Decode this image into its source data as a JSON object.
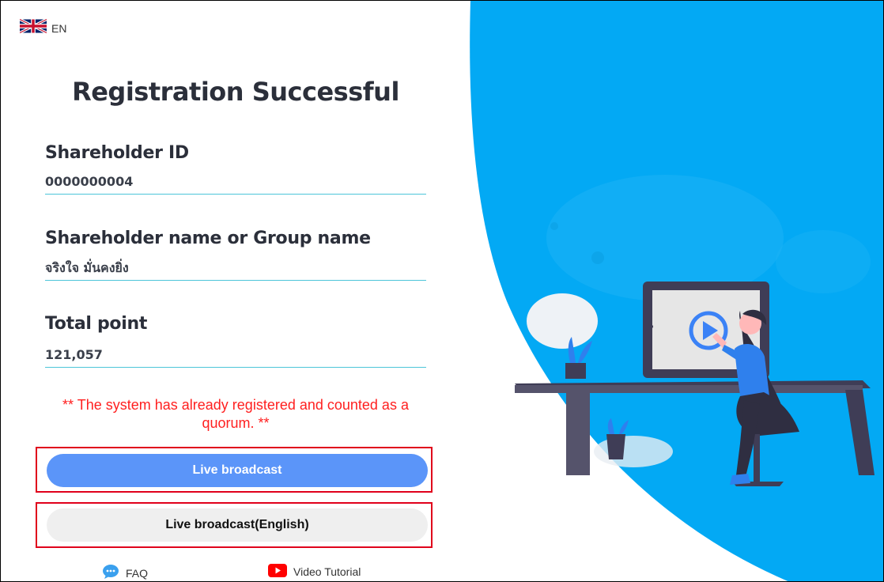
{
  "header": {
    "language_code": "EN",
    "flag_icon": "uk-flag-icon"
  },
  "form": {
    "title": "Registration Successful",
    "shareholder_id": {
      "label": "Shareholder ID",
      "value": "0000000004"
    },
    "shareholder_name": {
      "label": "Shareholder name or Group name",
      "value": "จริงใจ มั่นคงยิ่ง"
    },
    "total_point": {
      "label": "Total point",
      "value": "121,057"
    },
    "notice": "** The system has already registered and counted as a quorum. **"
  },
  "actions": {
    "live_broadcast": "Live broadcast",
    "live_broadcast_english": "Live broadcast(English)"
  },
  "footer": {
    "faq": "FAQ",
    "video_tutorial": "Video Tutorial"
  },
  "colors": {
    "accent_blue": "#5b95f9",
    "hero_blue": "#03a9f4",
    "notice_red": "#ff1f1f",
    "highlight_red": "#e0001b",
    "underline": "#4cc5d9"
  }
}
